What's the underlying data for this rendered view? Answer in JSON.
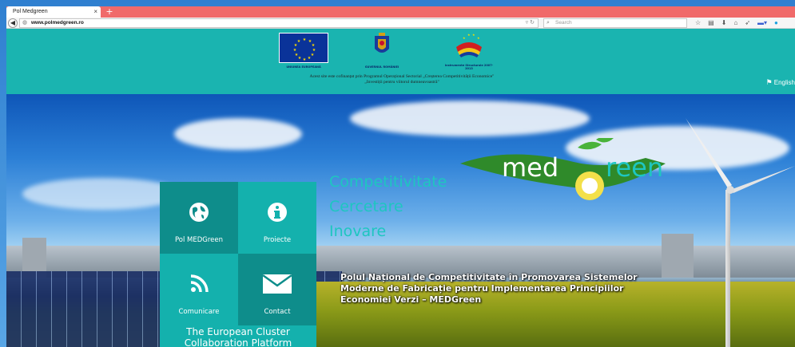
{
  "browser": {
    "tab_title": "Pol Medgreen",
    "tab_close": "×",
    "new_tab": "+",
    "url_domain": "www.polmedgreen.ro",
    "search_placeholder": "Search"
  },
  "eu_header": {
    "caption_eu": "UNIUNEA EUROPEANĂ",
    "caption_gov": "GUVERNUL ROMÂNIEI",
    "caption_sf": "Instrumente Structurale 2007-2013",
    "cofinance_line1": "Acest site este cofinanțat prin Programul Operațional Sectorial „Creșterea Competitivității Economice\"",
    "cofinance_line2": "„Investiții pentru viitorul dumneavoastră\"",
    "language": "English"
  },
  "tiles": [
    {
      "label": "Pol MEDGreen",
      "icon": "globe-icon"
    },
    {
      "label": "Proiecte",
      "icon": "info-icon"
    },
    {
      "label": "Comunicare",
      "icon": "rss-icon"
    },
    {
      "label": "Contact",
      "icon": "envelope-icon"
    }
  ],
  "cluster_link": {
    "line1": "The European Cluster",
    "line2": "Collaboration Platform"
  },
  "hero": {
    "tagline1": "Competitivitate",
    "tagline2": "Cercetare",
    "tagline3": "Inovare",
    "logo_text_left": "med",
    "logo_text_right": "reen",
    "description": "Polul Național de Competitivitate în Promovarea Sistemelor Moderne de Fabricație pentru Implementarea Principiilor Economiei Verzi – MEDGreen"
  },
  "colors": {
    "header_teal": "#1ab4b0",
    "tile_dark": "#0e8d8b",
    "tile_light": "#14b1ad",
    "tagline": "#1ec6c0",
    "logo_green": "#2f8a2a"
  }
}
